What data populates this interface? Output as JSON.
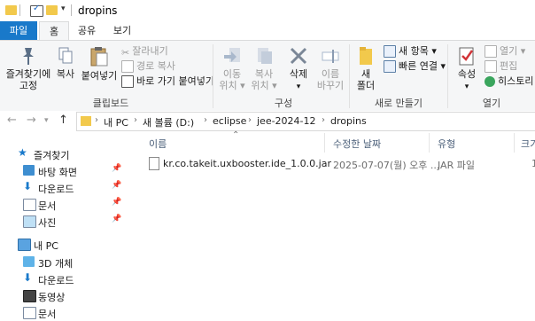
{
  "window": {
    "title": "dropins"
  },
  "tabs": [
    {
      "label": "파일"
    },
    {
      "label": "홈"
    },
    {
      "label": "공유"
    },
    {
      "label": "보기"
    }
  ],
  "ribbon": {
    "clipboard": {
      "pin_label_1": "즐겨찾기에",
      "pin_label_2": "고정",
      "copy_label": "복사",
      "paste_label": "붙여넣기",
      "cut_label": "잘라내기",
      "copy_path_label": "경로 복사",
      "paste_shortcut_label": "바로 가기 붙여넣기",
      "group_label": "클립보드"
    },
    "organize": {
      "move_1": "이동",
      "move_2": "위치",
      "copyto_1": "복사",
      "copyto_2": "위치",
      "delete_label": "삭제",
      "rename_1": "이름",
      "rename_2": "바꾸기",
      "group_label": "구성"
    },
    "new": {
      "new_folder_1": "새",
      "new_folder_2": "폴더",
      "new_item_label": "새 항목",
      "easy_access_label": "빠른 연결",
      "group_label": "새로 만들기"
    },
    "open": {
      "properties_label": "속성",
      "open_label": "열기",
      "edit_label": "편집",
      "history_label": "히스토리",
      "group_label": "열기"
    }
  },
  "address": {
    "breadcrumbs": [
      "내 PC",
      "새 볼륨 (D:)",
      "eclipse",
      "jee-2024-12",
      "dropins"
    ]
  },
  "nav_pane": {
    "quick_access_label": "즐겨찾기",
    "quick_items": [
      "바탕 화면",
      "다운로드",
      "문서",
      "사진"
    ],
    "this_pc_label": "내 PC",
    "pc_items": [
      "3D 개체",
      "다운로드",
      "동영상",
      "문서"
    ]
  },
  "file_list": {
    "columns": [
      "이름",
      "수정한 날짜",
      "유형",
      "크기"
    ],
    "rows": [
      {
        "name": "kr.co.takeit.uxbooster.ide_1.0.0.jar",
        "modified": "2025-07-07(월) 오후 ...",
        "type": "JAR 파일",
        "size": "1"
      }
    ]
  },
  "colors": {
    "accent": "#1979ca",
    "folder": "#f2c94c",
    "ribbon_bg": "#f5f6f7"
  }
}
